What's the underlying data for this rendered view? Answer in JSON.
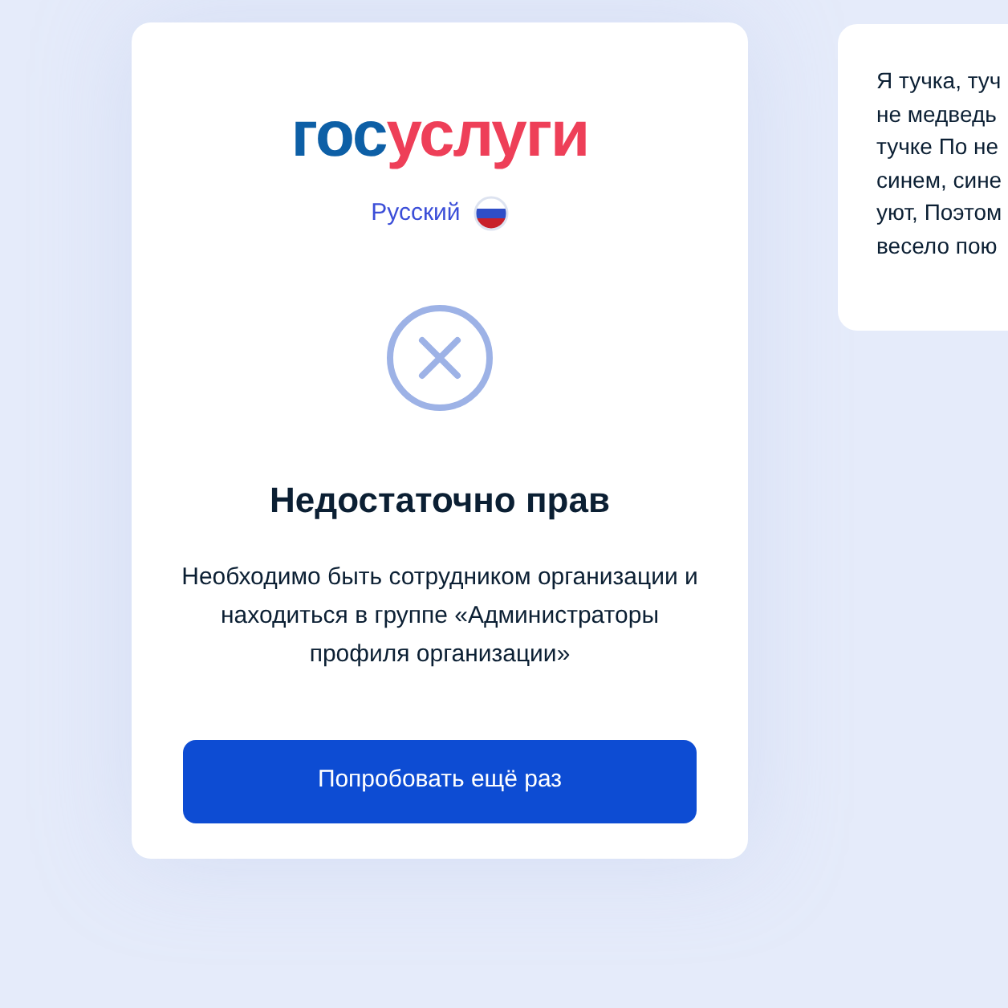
{
  "logo": {
    "part_1": "гос",
    "part_2": "услуги"
  },
  "language": {
    "label": "Русский"
  },
  "error": {
    "title": "Недостаточно прав",
    "message": "Необходимо быть сотрудником организации и находиться в группе «Администраторы профиля организации»"
  },
  "retry_button": {
    "label": "Попробовать ещё раз"
  },
  "side_card": {
    "lines": [
      "Я тучка, туч",
      "не медведь",
      "тучке По не",
      "синем, сине",
      "уют, Поэтом",
      "весело пою"
    ]
  }
}
